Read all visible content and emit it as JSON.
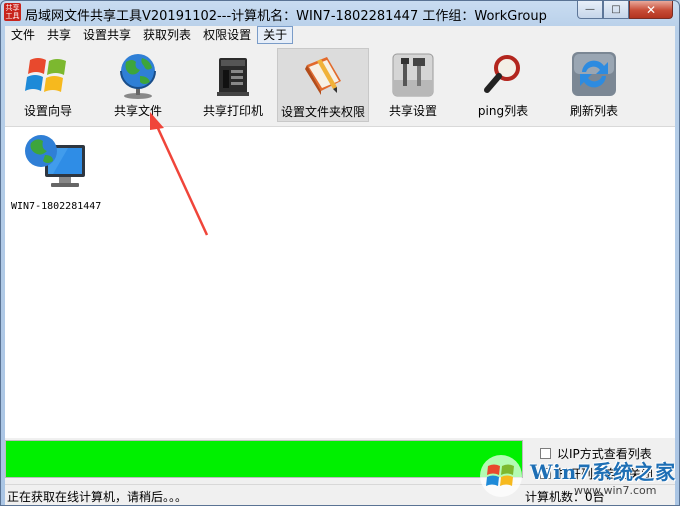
{
  "window": {
    "title": "局域网文件共享工具V20191102---计算机名：WIN7-1802281447  工作组：WorkGroup",
    "logo_text": "共享工具",
    "minimize": "—",
    "maximize": "□",
    "close": "✕"
  },
  "menu": {
    "items": [
      {
        "label": "文件"
      },
      {
        "label": "共享"
      },
      {
        "label": "设置共享"
      },
      {
        "label": "获取列表"
      },
      {
        "label": "权限设置"
      },
      {
        "label": "关于"
      }
    ]
  },
  "toolbar": {
    "buttons": [
      {
        "label": "设置向导",
        "icon": "windows-logo-icon"
      },
      {
        "label": "共享文件",
        "icon": "globe-icon"
      },
      {
        "label": "共享打印机",
        "icon": "printer-server-icon"
      },
      {
        "label": "设置文件夹权限",
        "icon": "book-pencil-icon"
      },
      {
        "label": "共享设置",
        "icon": "tools-icon"
      },
      {
        "label": "ping列表",
        "icon": "magnifier-icon"
      },
      {
        "label": "刷新列表",
        "icon": "refresh-icon"
      }
    ]
  },
  "computers": [
    {
      "name": "WIN7-1802281447",
      "icon": "network-computer-icon"
    }
  ],
  "progress": {
    "value": 1.0,
    "color": "#00f000"
  },
  "options": {
    "ip_view": "以IP方式查看列表",
    "auto_close": "打开列表自动关闭"
  },
  "status": {
    "text": "正在获取在线计算机，请稍后。。。",
    "count": "计算机数：0台"
  },
  "watermark": {
    "brand": "Win7系统之家",
    "url": "www.win7.com"
  }
}
